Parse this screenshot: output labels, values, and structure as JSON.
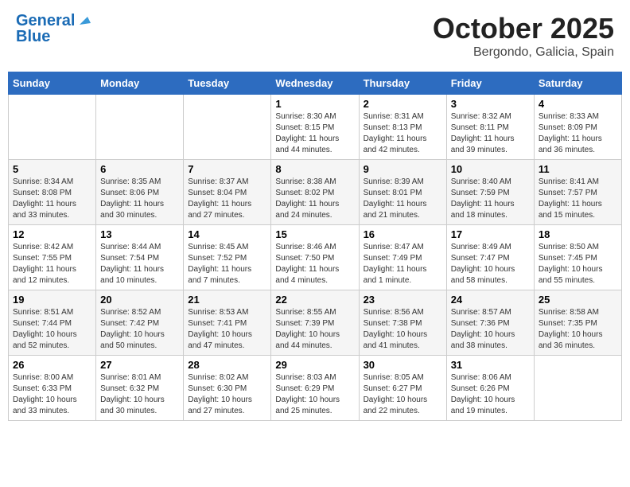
{
  "header": {
    "logo_line1": "General",
    "logo_line2": "Blue",
    "month_title": "October 2025",
    "location": "Bergondo, Galicia, Spain"
  },
  "days_of_week": [
    "Sunday",
    "Monday",
    "Tuesday",
    "Wednesday",
    "Thursday",
    "Friday",
    "Saturday"
  ],
  "weeks": [
    [
      {
        "day": "",
        "sunrise": "",
        "sunset": "",
        "daylight": ""
      },
      {
        "day": "",
        "sunrise": "",
        "sunset": "",
        "daylight": ""
      },
      {
        "day": "",
        "sunrise": "",
        "sunset": "",
        "daylight": ""
      },
      {
        "day": "1",
        "sunrise": "Sunrise: 8:30 AM",
        "sunset": "Sunset: 8:15 PM",
        "daylight": "Daylight: 11 hours and 44 minutes."
      },
      {
        "day": "2",
        "sunrise": "Sunrise: 8:31 AM",
        "sunset": "Sunset: 8:13 PM",
        "daylight": "Daylight: 11 hours and 42 minutes."
      },
      {
        "day": "3",
        "sunrise": "Sunrise: 8:32 AM",
        "sunset": "Sunset: 8:11 PM",
        "daylight": "Daylight: 11 hours and 39 minutes."
      },
      {
        "day": "4",
        "sunrise": "Sunrise: 8:33 AM",
        "sunset": "Sunset: 8:09 PM",
        "daylight": "Daylight: 11 hours and 36 minutes."
      }
    ],
    [
      {
        "day": "5",
        "sunrise": "Sunrise: 8:34 AM",
        "sunset": "Sunset: 8:08 PM",
        "daylight": "Daylight: 11 hours and 33 minutes."
      },
      {
        "day": "6",
        "sunrise": "Sunrise: 8:35 AM",
        "sunset": "Sunset: 8:06 PM",
        "daylight": "Daylight: 11 hours and 30 minutes."
      },
      {
        "day": "7",
        "sunrise": "Sunrise: 8:37 AM",
        "sunset": "Sunset: 8:04 PM",
        "daylight": "Daylight: 11 hours and 27 minutes."
      },
      {
        "day": "8",
        "sunrise": "Sunrise: 8:38 AM",
        "sunset": "Sunset: 8:02 PM",
        "daylight": "Daylight: 11 hours and 24 minutes."
      },
      {
        "day": "9",
        "sunrise": "Sunrise: 8:39 AM",
        "sunset": "Sunset: 8:01 PM",
        "daylight": "Daylight: 11 hours and 21 minutes."
      },
      {
        "day": "10",
        "sunrise": "Sunrise: 8:40 AM",
        "sunset": "Sunset: 7:59 PM",
        "daylight": "Daylight: 11 hours and 18 minutes."
      },
      {
        "day": "11",
        "sunrise": "Sunrise: 8:41 AM",
        "sunset": "Sunset: 7:57 PM",
        "daylight": "Daylight: 11 hours and 15 minutes."
      }
    ],
    [
      {
        "day": "12",
        "sunrise": "Sunrise: 8:42 AM",
        "sunset": "Sunset: 7:55 PM",
        "daylight": "Daylight: 11 hours and 12 minutes."
      },
      {
        "day": "13",
        "sunrise": "Sunrise: 8:44 AM",
        "sunset": "Sunset: 7:54 PM",
        "daylight": "Daylight: 11 hours and 10 minutes."
      },
      {
        "day": "14",
        "sunrise": "Sunrise: 8:45 AM",
        "sunset": "Sunset: 7:52 PM",
        "daylight": "Daylight: 11 hours and 7 minutes."
      },
      {
        "day": "15",
        "sunrise": "Sunrise: 8:46 AM",
        "sunset": "Sunset: 7:50 PM",
        "daylight": "Daylight: 11 hours and 4 minutes."
      },
      {
        "day": "16",
        "sunrise": "Sunrise: 8:47 AM",
        "sunset": "Sunset: 7:49 PM",
        "daylight": "Daylight: 11 hours and 1 minute."
      },
      {
        "day": "17",
        "sunrise": "Sunrise: 8:49 AM",
        "sunset": "Sunset: 7:47 PM",
        "daylight": "Daylight: 10 hours and 58 minutes."
      },
      {
        "day": "18",
        "sunrise": "Sunrise: 8:50 AM",
        "sunset": "Sunset: 7:45 PM",
        "daylight": "Daylight: 10 hours and 55 minutes."
      }
    ],
    [
      {
        "day": "19",
        "sunrise": "Sunrise: 8:51 AM",
        "sunset": "Sunset: 7:44 PM",
        "daylight": "Daylight: 10 hours and 52 minutes."
      },
      {
        "day": "20",
        "sunrise": "Sunrise: 8:52 AM",
        "sunset": "Sunset: 7:42 PM",
        "daylight": "Daylight: 10 hours and 50 minutes."
      },
      {
        "day": "21",
        "sunrise": "Sunrise: 8:53 AM",
        "sunset": "Sunset: 7:41 PM",
        "daylight": "Daylight: 10 hours and 47 minutes."
      },
      {
        "day": "22",
        "sunrise": "Sunrise: 8:55 AM",
        "sunset": "Sunset: 7:39 PM",
        "daylight": "Daylight: 10 hours and 44 minutes."
      },
      {
        "day": "23",
        "sunrise": "Sunrise: 8:56 AM",
        "sunset": "Sunset: 7:38 PM",
        "daylight": "Daylight: 10 hours and 41 minutes."
      },
      {
        "day": "24",
        "sunrise": "Sunrise: 8:57 AM",
        "sunset": "Sunset: 7:36 PM",
        "daylight": "Daylight: 10 hours and 38 minutes."
      },
      {
        "day": "25",
        "sunrise": "Sunrise: 8:58 AM",
        "sunset": "Sunset: 7:35 PM",
        "daylight": "Daylight: 10 hours and 36 minutes."
      }
    ],
    [
      {
        "day": "26",
        "sunrise": "Sunrise: 8:00 AM",
        "sunset": "Sunset: 6:33 PM",
        "daylight": "Daylight: 10 hours and 33 minutes."
      },
      {
        "day": "27",
        "sunrise": "Sunrise: 8:01 AM",
        "sunset": "Sunset: 6:32 PM",
        "daylight": "Daylight: 10 hours and 30 minutes."
      },
      {
        "day": "28",
        "sunrise": "Sunrise: 8:02 AM",
        "sunset": "Sunset: 6:30 PM",
        "daylight": "Daylight: 10 hours and 27 minutes."
      },
      {
        "day": "29",
        "sunrise": "Sunrise: 8:03 AM",
        "sunset": "Sunset: 6:29 PM",
        "daylight": "Daylight: 10 hours and 25 minutes."
      },
      {
        "day": "30",
        "sunrise": "Sunrise: 8:05 AM",
        "sunset": "Sunset: 6:27 PM",
        "daylight": "Daylight: 10 hours and 22 minutes."
      },
      {
        "day": "31",
        "sunrise": "Sunrise: 8:06 AM",
        "sunset": "Sunset: 6:26 PM",
        "daylight": "Daylight: 10 hours and 19 minutes."
      },
      {
        "day": "",
        "sunrise": "",
        "sunset": "",
        "daylight": ""
      }
    ]
  ]
}
